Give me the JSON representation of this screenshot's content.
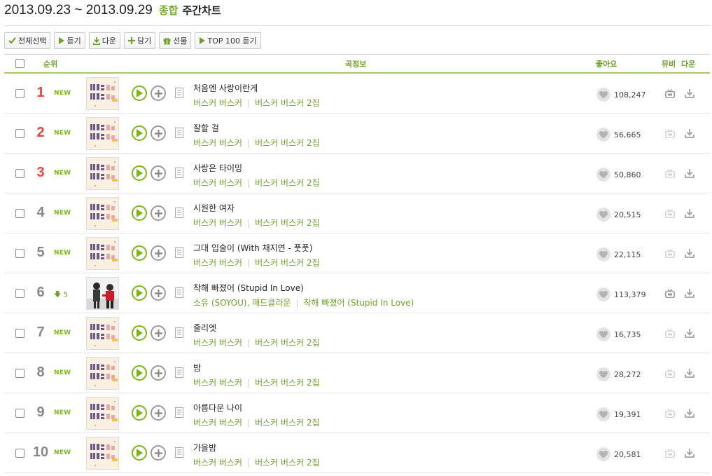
{
  "header": {
    "date_range": "2013.09.23 ~ 2013.09.29",
    "category": "종합",
    "chart_name": "주간차트"
  },
  "toolbar": {
    "select_all": "전체선택",
    "listen": "듣기",
    "download": "다운",
    "add": "담기",
    "gift": "선물",
    "top100": "TOP 100 듣기"
  },
  "columns": {
    "rank": "순위",
    "song_info": "곡정보",
    "likes": "좋아요",
    "mv": "뮤비",
    "down": "다운"
  },
  "colors": {
    "accent": "#7cb518",
    "rank_top": "#e8443b",
    "rank_other": "#888888"
  },
  "rows": [
    {
      "rank": "1",
      "change": "NEW",
      "title": "처음엔 사랑이란게",
      "artist": "버스커 버스커",
      "album": "버스커 버스커 2집",
      "likes": "108,247",
      "thumb": "album-cover"
    },
    {
      "rank": "2",
      "change": "NEW",
      "title": "잘할 걸",
      "artist": "버스커 버스커",
      "album": "버스커 버스커 2집",
      "likes": "56,665",
      "thumb": "album-cover"
    },
    {
      "rank": "3",
      "change": "NEW",
      "title": "사랑은 타이밍",
      "artist": "버스커 버스커",
      "album": "버스커 버스커 2집",
      "likes": "50,860",
      "thumb": "album-cover"
    },
    {
      "rank": "4",
      "change": "NEW",
      "title": "시원한 여자",
      "artist": "버스커 버스커",
      "album": "버스커 버스커 2집",
      "likes": "20,515",
      "thumb": "album-cover"
    },
    {
      "rank": "5",
      "change": "NEW",
      "title": "그대 입술이 (With 채지연 - 풋풋)",
      "artist": "버스커 버스커",
      "album": "버스커 버스커 2집",
      "likes": "22,115",
      "thumb": "album-cover"
    },
    {
      "rank": "6",
      "change": "5",
      "change_dir": "down",
      "title": "착해 빠졌어 (Stupid In Love)",
      "artist": "소유 (SOYOU), 매드클라운",
      "album": "착해 빠졌어 (Stupid In Love)",
      "likes": "113,379",
      "thumb": "photo-cover"
    },
    {
      "rank": "7",
      "change": "NEW",
      "title": "줄리엣",
      "artist": "버스커 버스커",
      "album": "버스커 버스커 2집",
      "likes": "16,735",
      "thumb": "album-cover"
    },
    {
      "rank": "8",
      "change": "NEW",
      "title": "밤",
      "artist": "버스커 버스커",
      "album": "버스커 버스커 2집",
      "likes": "28,272",
      "thumb": "album-cover"
    },
    {
      "rank": "9",
      "change": "NEW",
      "title": "아름다운 나이",
      "artist": "버스커 버스커",
      "album": "버스커 버스커 2집",
      "likes": "19,391",
      "thumb": "album-cover"
    },
    {
      "rank": "10",
      "change": "NEW",
      "title": "가을밤",
      "artist": "버스커 버스커",
      "album": "버스커 버스커 2집",
      "likes": "20,581",
      "thumb": "album-cover"
    }
  ]
}
